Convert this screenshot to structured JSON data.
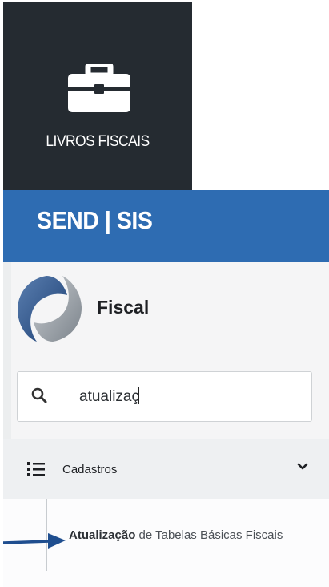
{
  "tile": {
    "label": "LIVROS FISCAIS",
    "icon": "briefcase-icon"
  },
  "header": {
    "title": "SEND | SIS"
  },
  "module": {
    "name": "Fiscal",
    "logo": "sendsis-logo"
  },
  "search": {
    "value": "atualizaç",
    "icon": "search-icon"
  },
  "menu": {
    "section_label": "Cadastros",
    "section_icon": "list-icon",
    "expand_icon": "chevron-down-icon",
    "items": [
      {
        "label_match": "Atualização",
        "label_rest": " de Tabelas Básicas Fiscais"
      }
    ]
  },
  "colors": {
    "tile_bg": "#252b31",
    "header_bg": "#2e6cb2",
    "arrow": "#1f4e8f"
  }
}
